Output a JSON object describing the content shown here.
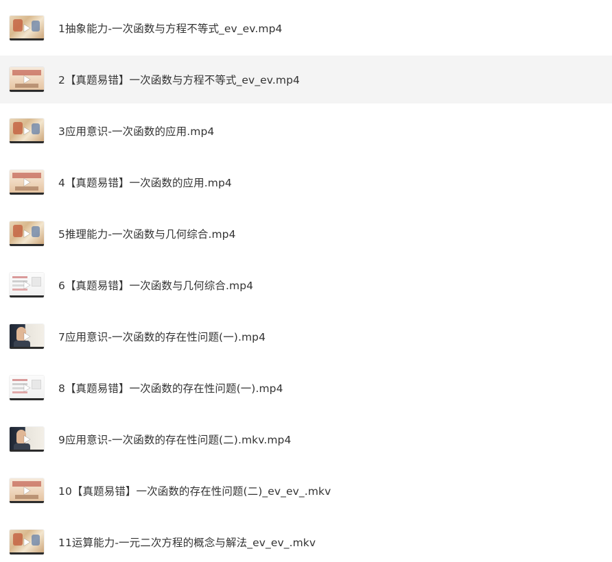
{
  "files": [
    {
      "name": "1抽象能力-一次函数与方程不等式_ev_ev.mp4",
      "thumb_style": "cartoon",
      "icon": "play-icon"
    },
    {
      "name": "2【真题易错】一次函数与方程不等式_ev_ev.mp4",
      "thumb_style": "red",
      "icon": "play-icon",
      "hovered": true
    },
    {
      "name": "3应用意识-一次函数的应用.mp4",
      "thumb_style": "cartoon",
      "icon": "play-icon"
    },
    {
      "name": "4【真题易错】一次函数的应用.mp4",
      "thumb_style": "red",
      "icon": "play-icon"
    },
    {
      "name": "5推理能力-一次函数与几何综合.mp4",
      "thumb_style": "cartoon",
      "icon": "play-icon"
    },
    {
      "name": "6【真题易错】一次函数与几何综合.mp4",
      "thumb_style": "light",
      "icon": "play-icon"
    },
    {
      "name": "7应用意识-一次函数的存在性问题(一).mp4",
      "thumb_style": "dark",
      "icon": "play-icon"
    },
    {
      "name": "8【真题易错】一次函数的存在性问题(一).mp4",
      "thumb_style": "light",
      "icon": "play-icon"
    },
    {
      "name": "9应用意识-一次函数的存在性问题(二).mkv.mp4",
      "thumb_style": "dark",
      "icon": "play-icon"
    },
    {
      "name": "10【真题易错】一次函数的存在性问题(二)_ev_ev_.mkv",
      "thumb_style": "red",
      "icon": "play-icon"
    },
    {
      "name": "11运算能力-一元二次方程的概念与解法_ev_ev_.mkv",
      "thumb_style": "cartoon",
      "icon": "play-icon"
    }
  ],
  "colors": {
    "text": "#333333",
    "hover_background": "#f4f4f4",
    "play_icon": "#ffffff"
  }
}
